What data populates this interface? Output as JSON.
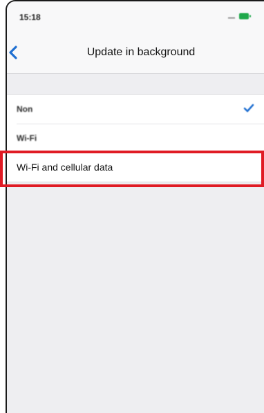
{
  "status_bar": {
    "time": "15:18",
    "signal_icon": "signal-dash-icon",
    "battery_icon": "battery-icon",
    "battery_color": "#1ea84a"
  },
  "nav": {
    "title": "Update in background",
    "back_icon": "chevron-left-icon",
    "accent_color": "#1f6fd1"
  },
  "options": [
    {
      "label": "Non",
      "selected": true
    },
    {
      "label": "Wi-Fi",
      "selected": false
    },
    {
      "label": "Wi-Fi and cellular data",
      "selected": false,
      "highlighted": true
    }
  ],
  "highlight_color": "#e01b24",
  "check_icon": "checkmark-icon"
}
